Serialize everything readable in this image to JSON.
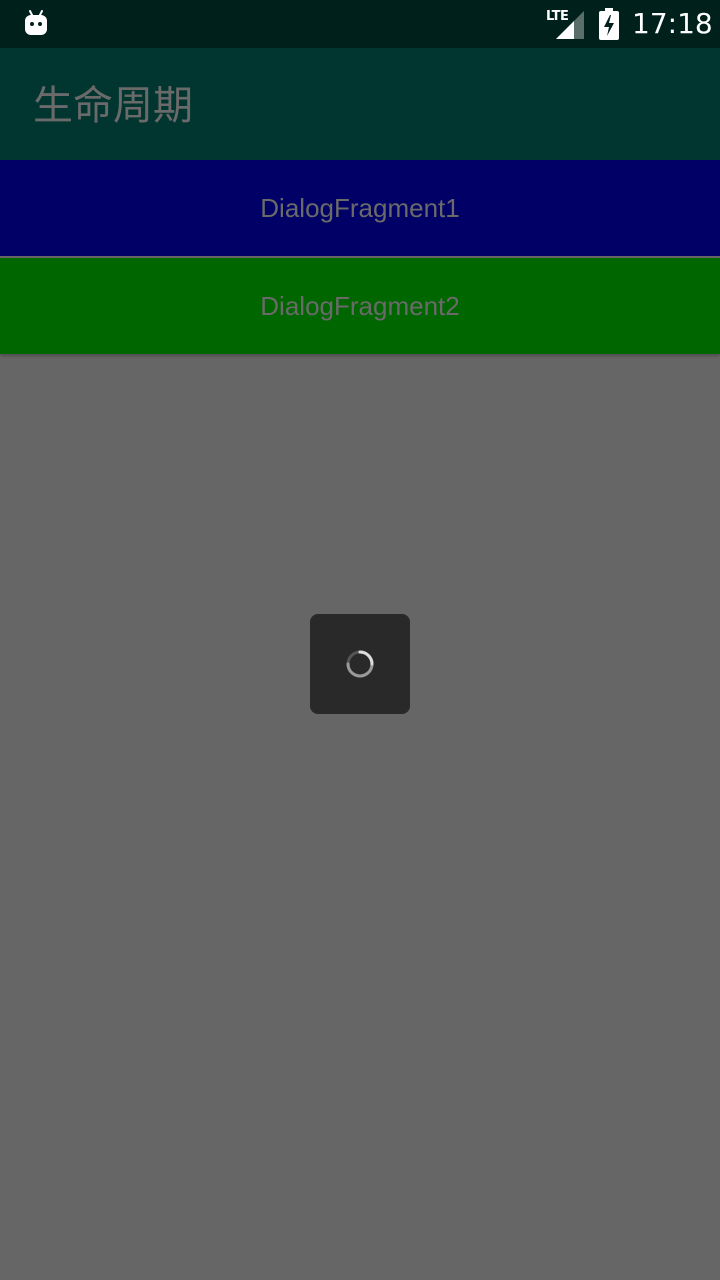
{
  "status_bar": {
    "left_icon": "android-debug-icon",
    "network_label": "LTE",
    "signal_icon": "cell-signal-icon",
    "battery_icon": "battery-charging-icon",
    "time": "17:18"
  },
  "app_bar": {
    "title": "生命周期"
  },
  "buttons": [
    {
      "label": "DialogFragment1",
      "color": "#000066"
    },
    {
      "label": "DialogFragment2",
      "color": "#006600"
    }
  ],
  "dialog": {
    "type": "progress",
    "icon": "loading-spinner-icon"
  },
  "colors": {
    "status_bar": "#00201c",
    "app_bar": "#003530",
    "background": "#666666",
    "dialog": "#292929",
    "text_muted": "#6a6a6a"
  }
}
